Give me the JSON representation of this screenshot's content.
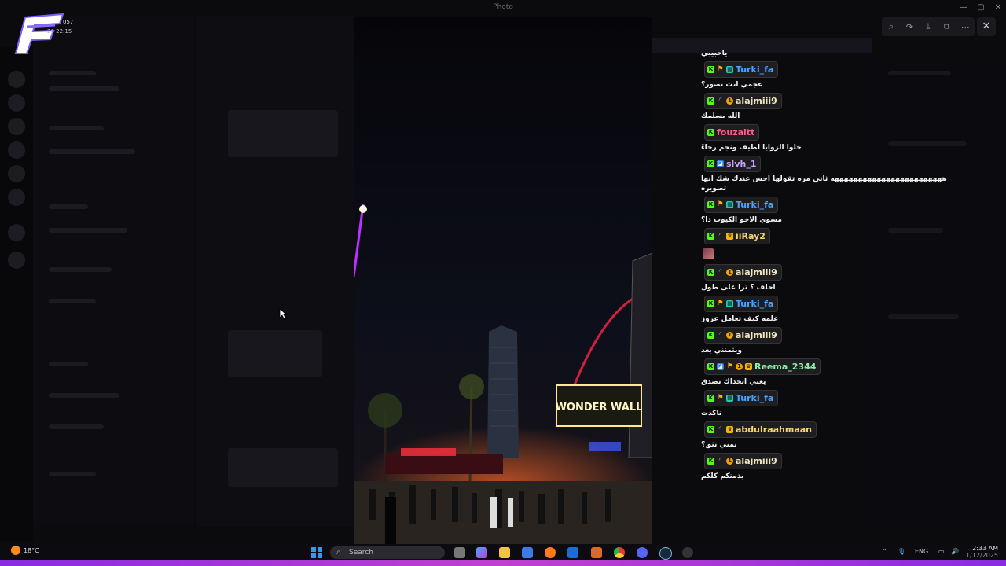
{
  "window": {
    "title": "Photo"
  },
  "overlay": {
    "logo_badge": "057",
    "logo_date": "26 22:15"
  },
  "viewer": {
    "tools": [
      "zoom-in-icon",
      "share-icon",
      "download-icon",
      "open-external-icon",
      "more-icon"
    ],
    "close": "✕"
  },
  "photo": {
    "sign": "WONDER WALL"
  },
  "chat": {
    "top_text": "ياحبيبي",
    "messages": [
      {
        "user": "Turki_fa",
        "color": "#4aa3ff",
        "badges": [
          "k",
          "flag",
          "gift"
        ],
        "text": "عجمي انت تصور؟"
      },
      {
        "user": "alajmiii9",
        "color": "#f0e6c0",
        "badges": [
          "k",
          "moon",
          "one"
        ],
        "text": "الله يسلمك"
      },
      {
        "user": "fouzaltt",
        "color": "#ff5a8a",
        "badges": [
          "k"
        ],
        "text": "خلوا الزوايا لطيف ونجم رجاءً"
      },
      {
        "user": "slvh_1",
        "color": "#c8a0ff",
        "badges": [
          "k",
          "blue"
        ],
        "text": "ههههههههههههههههههههههههه ثاني مره تقولها احس عندك شك انها تصويره"
      },
      {
        "user": "Turki_fa",
        "color": "#4aa3ff",
        "badges": [
          "k",
          "flag",
          "gift"
        ],
        "text": "مسوي الاخو الكيوت ذا؟"
      },
      {
        "user": "iiRay2",
        "color": "#f5d76e",
        "badges": [
          "k",
          "moon",
          "crown"
        ],
        "text": "",
        "sticker": true
      },
      {
        "user": "alajmiii9",
        "color": "#f0e6c0",
        "badges": [
          "k",
          "moon",
          "one"
        ],
        "text": "احلف ؟ ترا على طول"
      },
      {
        "user": "Turki_fa",
        "color": "#4aa3ff",
        "badges": [
          "k",
          "flag",
          "gift"
        ],
        "text": "علمه كيف تعامل عزوز"
      },
      {
        "user": "alajmiii9",
        "color": "#f0e6c0",
        "badges": [
          "k",
          "moon",
          "one"
        ],
        "text": "ويثمنني بعد"
      },
      {
        "user": "Reema_2344",
        "color": "#8ef0a8",
        "badges": [
          "k",
          "blue",
          "flag",
          "one",
          "crown"
        ],
        "text": "يعني اتحداك تصدق"
      },
      {
        "user": "Turki_fa",
        "color": "#4aa3ff",
        "badges": [
          "k",
          "flag",
          "gift"
        ],
        "text": "تاكدت"
      },
      {
        "user": "abdulraahmaan",
        "color": "#f5d76e",
        "badges": [
          "k",
          "moon",
          "crown"
        ],
        "text": "تمني تثق؟"
      },
      {
        "user": "alajmiii9",
        "color": "#f0e6c0",
        "badges": [
          "k",
          "moon",
          "one"
        ],
        "text": "بذمتكم كلكم"
      }
    ]
  },
  "taskbar": {
    "weather": "18°C",
    "weather_badge": "2",
    "search_placeholder": "Search",
    "lang": "ENG",
    "time": "2:33 AM",
    "date": "1/12/2025"
  }
}
